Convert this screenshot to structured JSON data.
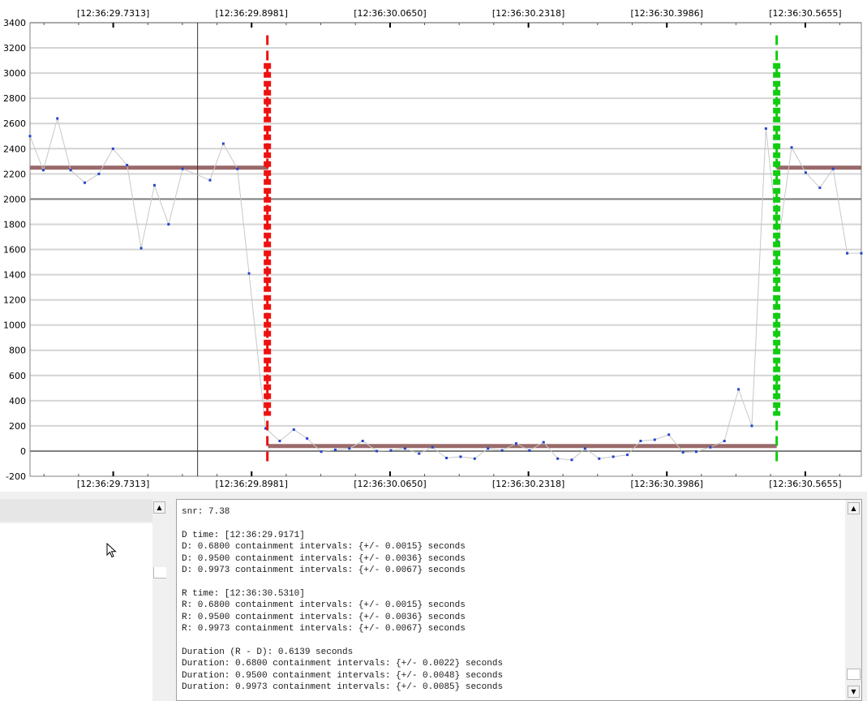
{
  "chart_data": {
    "type": "line",
    "x_tick_labels": [
      "[12:36:29.7313]",
      "[12:36:29.8981]",
      "[12:36:30.0650]",
      "[12:36:30.2318]",
      "[12:36:30.3986]",
      "[12:36:30.5655]"
    ],
    "x_ticks_seconds": [
      29.7313,
      29.8981,
      30.065,
      30.2318,
      30.3986,
      30.5655
    ],
    "xlim_seconds": [
      29.631,
      30.633
    ],
    "ylim": [
      -200,
      3400
    ],
    "y_tick_labels": [
      "3400",
      "3200",
      "3000",
      "2800",
      "2600",
      "2400",
      "2200",
      "2000",
      "1800",
      "1600",
      "1400",
      "1200",
      "1000",
      "800",
      "600",
      "400",
      "200",
      "0",
      "-200"
    ],
    "y_ticks": [
      3400,
      3200,
      3000,
      2800,
      2600,
      2400,
      2200,
      2000,
      1800,
      1600,
      1400,
      1200,
      1000,
      800,
      600,
      400,
      200,
      0,
      -200
    ],
    "series": [
      {
        "color": "#2244cc",
        "line_color": "#c8c8c8",
        "x": [
          29.631,
          29.647,
          29.664,
          29.68,
          29.697,
          29.714,
          29.731,
          29.748,
          29.765,
          29.781,
          29.798,
          29.815,
          29.848,
          29.864,
          29.881,
          29.895,
          29.915,
          29.932,
          29.949,
          29.965,
          29.982,
          29.999,
          30.016,
          30.032,
          30.049,
          30.066,
          30.083,
          30.1,
          30.116,
          30.133,
          30.15,
          30.167,
          30.183,
          30.2,
          30.217,
          30.233,
          30.25,
          30.267,
          30.284,
          30.3,
          30.317,
          30.334,
          30.351,
          30.367,
          30.384,
          30.401,
          30.418,
          30.434,
          30.451,
          30.468,
          30.485,
          30.501,
          30.518,
          30.533,
          30.549,
          30.566,
          30.583,
          30.599,
          30.616,
          30.633
        ],
        "y": [
          2500,
          2230,
          2640,
          2230,
          2130,
          2200,
          2400,
          2270,
          1610,
          2110,
          1800,
          2240,
          2150,
          2440,
          2240,
          1410,
          180,
          80,
          170,
          100,
          -5,
          10,
          20,
          80,
          0,
          5,
          20,
          -20,
          30,
          -55,
          -45,
          -60,
          20,
          5,
          60,
          5,
          70,
          -60,
          -70,
          20,
          -60,
          -45,
          -30,
          80,
          90,
          130,
          -10,
          -5,
          30,
          80,
          490,
          200,
          2560,
          1660,
          2410,
          2210,
          2090,
          2240,
          1570,
          1570
        ]
      }
    ],
    "level_lines": [
      {
        "color": "#9a6a6a",
        "y": 2250,
        "x_range": [
          29.631,
          29.918
        ]
      },
      {
        "color": "#9a6a6a",
        "y": 40,
        "x_range": [
          29.918,
          30.531
        ]
      },
      {
        "color": "#9a6a6a",
        "y": 2250,
        "x_range": [
          30.531,
          30.633
        ]
      }
    ],
    "horizontal_ref_lines": [
      2000,
      0
    ],
    "cursor_line_x": 29.833,
    "event_markers": [
      {
        "label": "D",
        "color": "#ee1111",
        "x": 29.9171
      },
      {
        "label": "R",
        "color": "#11cc11",
        "x": 30.531
      }
    ],
    "grid": true
  },
  "results_text": {
    "lines": [
      "snr: 7.38",
      "",
      "D time: [12:36:29.9171]",
      "D: 0.6800 containment intervals: {+/- 0.0015} seconds",
      "D: 0.9500 containment intervals: {+/- 0.0036} seconds",
      "D: 0.9973 containment intervals: {+/- 0.0067} seconds",
      "",
      "R time: [12:36:30.5310]",
      "R: 0.6800 containment intervals: {+/- 0.0015} seconds",
      "R: 0.9500 containment intervals: {+/- 0.0036} seconds",
      "R: 0.9973 containment intervals: {+/- 0.0067} seconds",
      "",
      "Duration (R - D): 0.6139 seconds",
      "Duration: 0.6800 containment intervals: {+/- 0.0022} seconds",
      "Duration: 0.9500 containment intervals: {+/- 0.0048} seconds",
      "Duration: 0.9973 containment intervals: {+/- 0.0085} seconds"
    ]
  },
  "icons": {
    "scroll_up": "▲",
    "scroll_down": "▼"
  }
}
